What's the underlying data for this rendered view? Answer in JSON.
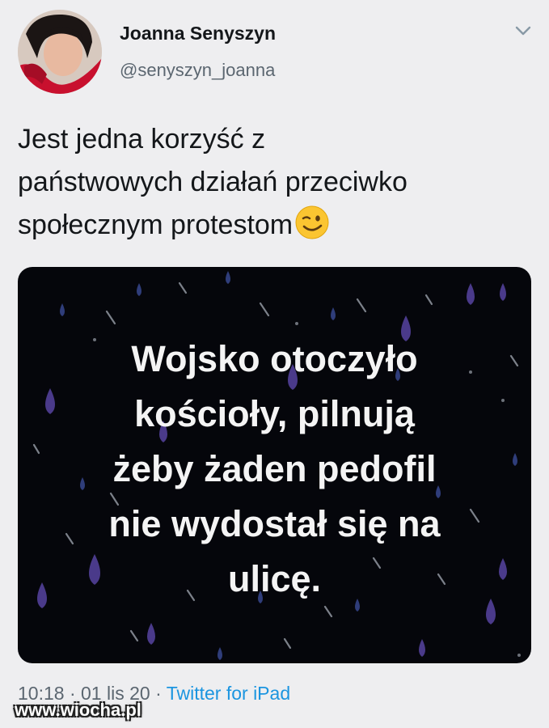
{
  "author": {
    "name": "Joanna Senyszyn",
    "handle": "@senyszyn_joanna"
  },
  "icons": {
    "menu": "chevron-down-icon",
    "emoji": "winking-face-emoji"
  },
  "tweet": {
    "text_lines": [
      "Jest jedna korzyść z",
      "państwowych działań przeciwko",
      "społecznym protestom"
    ]
  },
  "media": {
    "lines": [
      "Wojsko otoczyło",
      "kościoły, pilnują",
      "żeby żaden pedofil",
      "nie wydostał  się na",
      "ulicę."
    ]
  },
  "footer": {
    "timestamp": "10:18 · 01 lis 20",
    "separator": "·",
    "source": "Twitter for iPad"
  },
  "watermark": "www.wiocha.pl",
  "colors": {
    "background": "#eeeef0",
    "link": "#1b95e0",
    "media_bg": "#05060b",
    "drop": "#4a3a8a"
  }
}
